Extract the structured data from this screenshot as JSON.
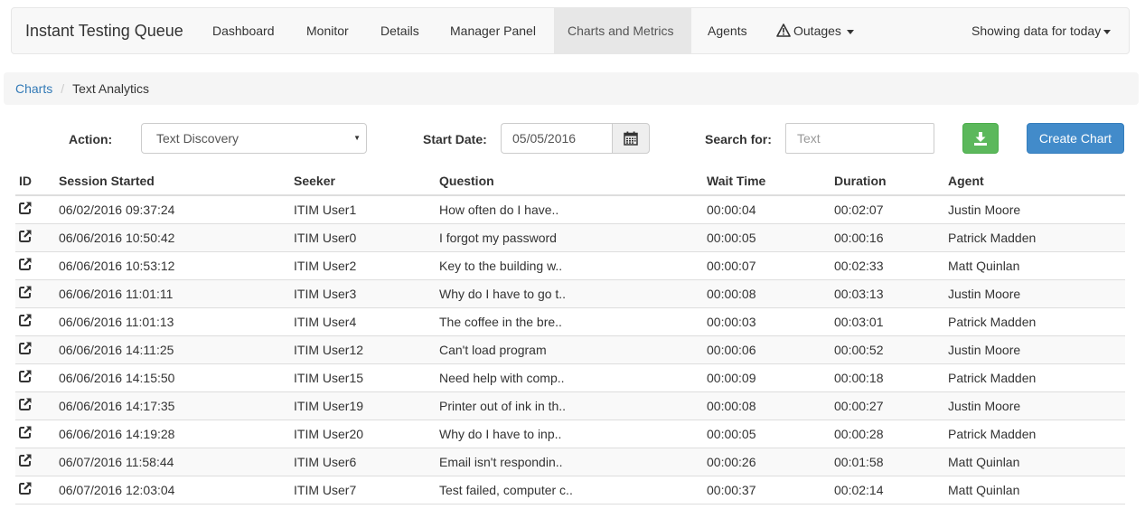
{
  "navbar": {
    "brand": "Instant Testing Queue",
    "items": [
      {
        "label": "Dashboard"
      },
      {
        "label": "Monitor"
      },
      {
        "label": "Details"
      },
      {
        "label": "Manager Panel"
      },
      {
        "label": "Charts and Metrics",
        "active": true
      },
      {
        "label": "Agents"
      },
      {
        "label": "Outages",
        "icon": "warning-icon",
        "dropdown": true
      }
    ],
    "right_dropdown": "Showing data for today"
  },
  "breadcrumb": {
    "items": [
      {
        "label": "Charts",
        "link": true
      },
      {
        "label": "Text Analytics",
        "link": false
      }
    ]
  },
  "filters": {
    "action_label": "Action:",
    "action_value": "Text Discovery",
    "start_date_label": "Start Date:",
    "start_date_value": "05/05/2016",
    "search_label": "Search for:",
    "search_placeholder": "Text",
    "download_icon": "download-icon",
    "calendar_icon": "calendar-icon",
    "create_button": "Create Chart"
  },
  "table": {
    "columns": [
      "ID",
      "Session Started",
      "Seeker",
      "Question",
      "Wait Time",
      "Duration",
      "Agent"
    ],
    "row_icon": "external-link-icon",
    "rows": [
      [
        "06/02/2016 09:37:24",
        "ITIM User1",
        "How often do I have..",
        "00:00:04",
        "00:02:07",
        "Justin Moore"
      ],
      [
        "06/06/2016 10:50:42",
        "ITIM User0",
        "I forgot my password",
        "00:00:05",
        "00:00:16",
        "Patrick Madden"
      ],
      [
        "06/06/2016 10:53:12",
        "ITIM User2",
        "Key to the building w..",
        "00:00:07",
        "00:02:33",
        "Matt Quinlan"
      ],
      [
        "06/06/2016 11:01:11",
        "ITIM User3",
        "Why do I have to go t..",
        "00:00:08",
        "00:03:13",
        "Justin Moore"
      ],
      [
        "06/06/2016 11:01:13",
        "ITIM User4",
        "The coffee in the bre..",
        "00:00:03",
        "00:03:01",
        "Patrick Madden"
      ],
      [
        "06/06/2016 14:11:25",
        "ITIM User12",
        "Can't load program",
        "00:00:06",
        "00:00:52",
        "Justin Moore"
      ],
      [
        "06/06/2016 14:15:50",
        "ITIM User15",
        "Need help with comp..",
        "00:00:09",
        "00:00:18",
        "Patrick Madden"
      ],
      [
        "06/06/2016 14:17:35",
        "ITIM User19",
        "Printer out of ink in th..",
        "00:00:08",
        "00:00:27",
        "Justin Moore"
      ],
      [
        "06/06/2016 14:19:28",
        "ITIM User20",
        "Why do I have to inp..",
        "00:00:05",
        "00:00:28",
        "Patrick Madden"
      ],
      [
        "06/07/2016 11:58:44",
        "ITIM User6",
        "Email isn't respondin..",
        "00:00:26",
        "00:01:58",
        "Matt Quinlan"
      ],
      [
        "06/07/2016 12:03:04",
        "ITIM User7",
        "Test failed, computer c..",
        "00:00:37",
        "00:02:14",
        "Matt Quinlan"
      ]
    ]
  },
  "colors": {
    "link": "#337ab7",
    "primary": "#428bca",
    "success": "#5cb85c"
  }
}
